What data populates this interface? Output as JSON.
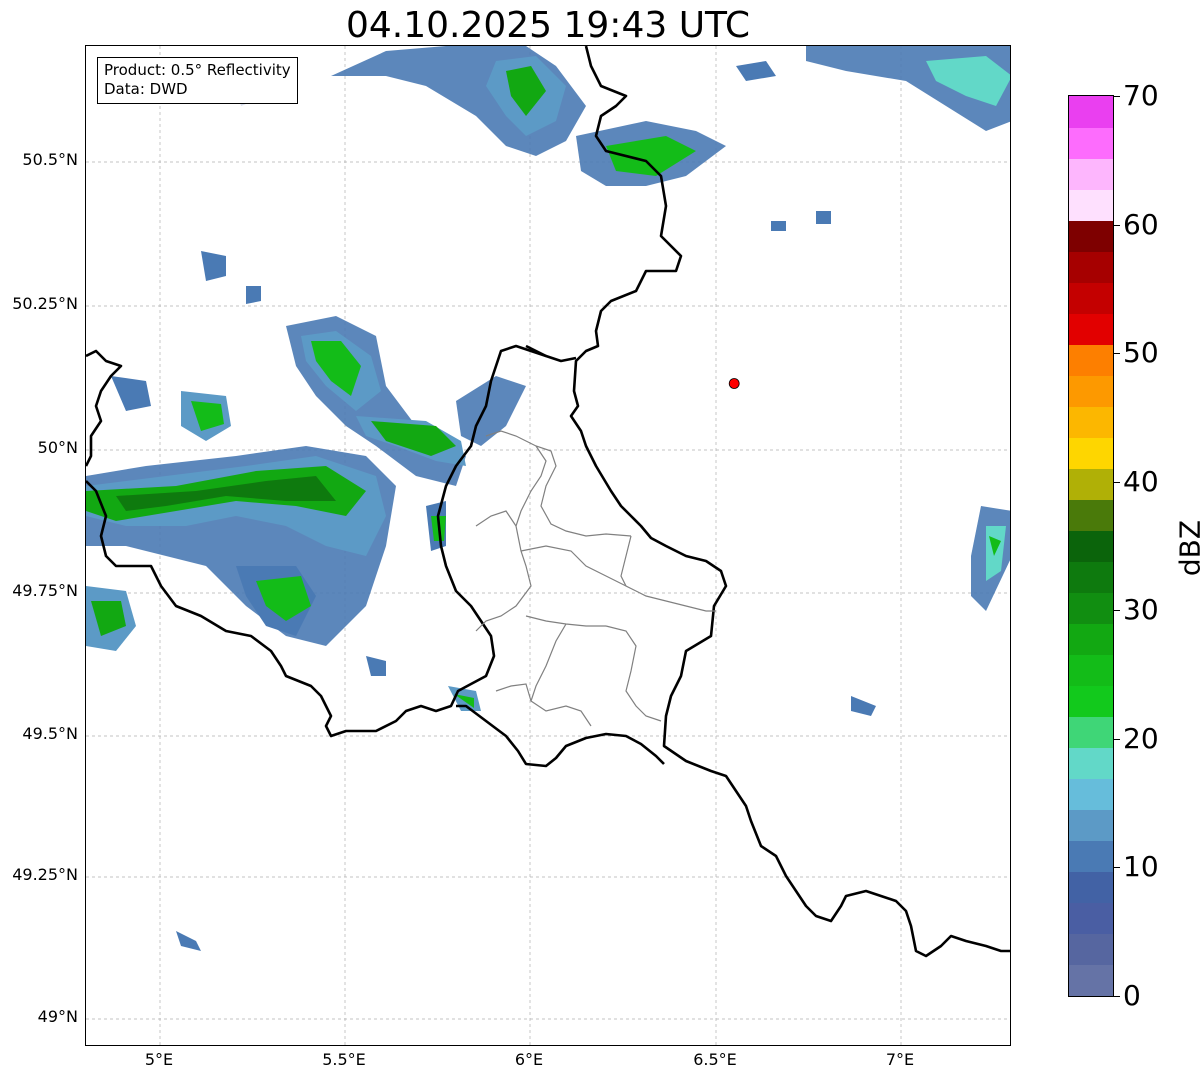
{
  "title": "04.10.2025 19:43 UTC",
  "info_box": {
    "line1": "Product: 0.5° Reflectivity",
    "line2": "Data: DWD"
  },
  "colorbar": {
    "label": "dBZ",
    "ticks": [
      "0",
      "10",
      "20",
      "30",
      "40",
      "50",
      "60",
      "70"
    ],
    "min": 0,
    "max": 70,
    "step": 2.5,
    "colors": [
      "#6573a6",
      "#5666a0",
      "#4a5ea3",
      "#4262a5",
      "#4a7ab4",
      "#5c9ac6",
      "#66bddb",
      "#62d8c8",
      "#3fd677",
      "#12c91c",
      "#13bc18",
      "#12a812",
      "#118e11",
      "#0e7a0e",
      "#0b640b",
      "#4a7a0a",
      "#b0b006",
      "#fed600",
      "#fcb700",
      "#fd9900",
      "#fd7f00",
      "#e20000",
      "#c40000",
      "#a60000",
      "#7e0000",
      "#fee0fe",
      "#fdb6fd",
      "#fd6cfd",
      "#ea3ff0"
    ]
  },
  "axes": {
    "lat_ticks": [
      "50.5°N",
      "50.25°N",
      "50°N",
      "49.75°N",
      "49.5°N",
      "49.25°N",
      "49°N"
    ],
    "lon_ticks": [
      "5°E",
      "5.5°E",
      "6°E",
      "6.5°E",
      "7°E"
    ],
    "lon_range": [
      4.8,
      7.3
    ],
    "lat_range": [
      48.95,
      50.7
    ]
  },
  "marker": {
    "lon": 6.55,
    "lat": 50.11,
    "color": "#ff0000"
  },
  "colors": {
    "border": "#000000",
    "region_border": "#808080",
    "grid": "#b0b0b0"
  }
}
